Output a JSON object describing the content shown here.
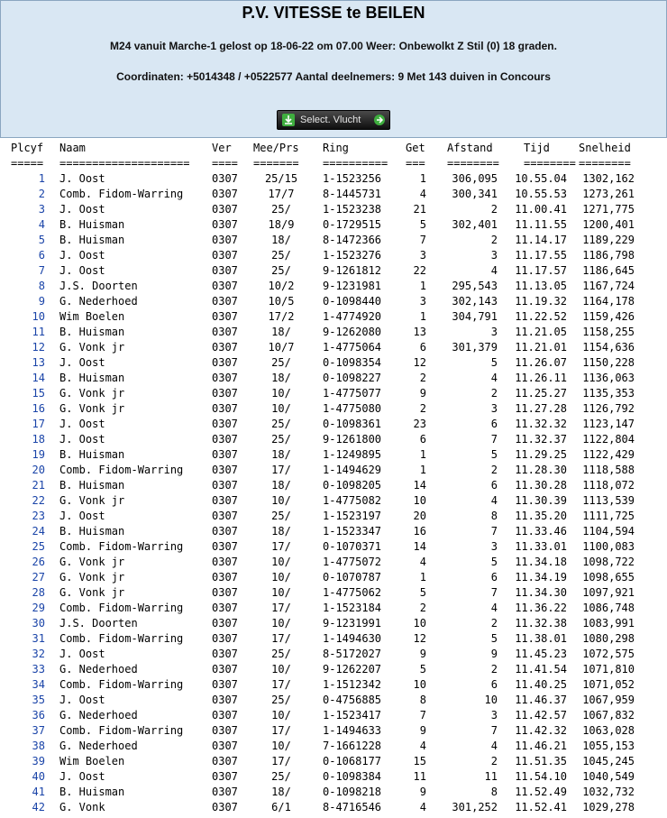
{
  "header": {
    "title": "P.V. VITESSE te BEILEN",
    "flight_info": "M24 vanuit Marche-1 gelost op 18-06-22 om 07.00 Weer: Onbewolkt Z Stil (0) 18 graden.",
    "coords_info": "Coordinaten: +5014348 / +0522577 Aantal deelnemers: 9 Met 143 duiven in Concours"
  },
  "toolbar": {
    "select_label": "Select. Vlucht",
    "icons": [
      "download-icon",
      "arrow-right-icon"
    ],
    "accent_color": "#3fae3f"
  },
  "table": {
    "headers": {
      "plcyf": "Plcyf",
      "naam": "Naam",
      "ver": "Ver",
      "mee": "Mee/Prs",
      "ring": "Ring",
      "get": "Get",
      "afstand": "Afstand",
      "tijd": "Tijd",
      "snelheid": "Snelheid"
    },
    "separators": {
      "plcyf": "=====",
      "naam": "====================",
      "ver": "====",
      "mee": "=======",
      "ring": "==========",
      "get": "===",
      "afstand": "========",
      "tijd": "========",
      "snelheid": "========"
    },
    "rows": [
      {
        "plc": "1",
        "naam": "J. Oost",
        "ver": "0307",
        "mee": "25/15",
        "ring": "1-1523256",
        "get": "1",
        "afstand": "306,095",
        "tijd": "10.55.04",
        "snelheid": "1302,162"
      },
      {
        "plc": "2",
        "naam": "Comb. Fidom-Warring",
        "ver": "0307",
        "mee": "17/7",
        "ring": "8-1445731",
        "get": "4",
        "afstand": "300,341",
        "tijd": "10.55.53",
        "snelheid": "1273,261"
      },
      {
        "plc": "3",
        "naam": "J. Oost",
        "ver": "0307",
        "mee": "25/",
        "ring": "1-1523238",
        "get": "21",
        "afstand": "2",
        "tijd": "11.00.41",
        "snelheid": "1271,775"
      },
      {
        "plc": "4",
        "naam": "B. Huisman",
        "ver": "0307",
        "mee": "18/9",
        "ring": "0-1729515",
        "get": "5",
        "afstand": "302,401",
        "tijd": "11.11.55",
        "snelheid": "1200,401"
      },
      {
        "plc": "5",
        "naam": "B. Huisman",
        "ver": "0307",
        "mee": "18/",
        "ring": "8-1472366",
        "get": "7",
        "afstand": "2",
        "tijd": "11.14.17",
        "snelheid": "1189,229"
      },
      {
        "plc": "6",
        "naam": "J. Oost",
        "ver": "0307",
        "mee": "25/",
        "ring": "1-1523276",
        "get": "3",
        "afstand": "3",
        "tijd": "11.17.55",
        "snelheid": "1186,798"
      },
      {
        "plc": "7",
        "naam": "J. Oost",
        "ver": "0307",
        "mee": "25/",
        "ring": "9-1261812",
        "get": "22",
        "afstand": "4",
        "tijd": "11.17.57",
        "snelheid": "1186,645"
      },
      {
        "plc": "8",
        "naam": "J.S. Doorten",
        "ver": "0307",
        "mee": "10/2",
        "ring": "9-1231981",
        "get": "1",
        "afstand": "295,543",
        "tijd": "11.13.05",
        "snelheid": "1167,724"
      },
      {
        "plc": "9",
        "naam": "G. Nederhoed",
        "ver": "0307",
        "mee": "10/5",
        "ring": "0-1098440",
        "get": "3",
        "afstand": "302,143",
        "tijd": "11.19.32",
        "snelheid": "1164,178"
      },
      {
        "plc": "10",
        "naam": "Wim Boelen",
        "ver": "0307",
        "mee": "17/2",
        "ring": "1-4774920",
        "get": "1",
        "afstand": "304,791",
        "tijd": "11.22.52",
        "snelheid": "1159,426"
      },
      {
        "plc": "11",
        "naam": "B. Huisman",
        "ver": "0307",
        "mee": "18/",
        "ring": "9-1262080",
        "get": "13",
        "afstand": "3",
        "tijd": "11.21.05",
        "snelheid": "1158,255"
      },
      {
        "plc": "12",
        "naam": "G. Vonk jr",
        "ver": "0307",
        "mee": "10/7",
        "ring": "1-4775064",
        "get": "6",
        "afstand": "301,379",
        "tijd": "11.21.01",
        "snelheid": "1154,636"
      },
      {
        "plc": "13",
        "naam": "J. Oost",
        "ver": "0307",
        "mee": "25/",
        "ring": "0-1098354",
        "get": "12",
        "afstand": "5",
        "tijd": "11.26.07",
        "snelheid": "1150,228"
      },
      {
        "plc": "14",
        "naam": "B. Huisman",
        "ver": "0307",
        "mee": "18/",
        "ring": "0-1098227",
        "get": "2",
        "afstand": "4",
        "tijd": "11.26.11",
        "snelheid": "1136,063"
      },
      {
        "plc": "15",
        "naam": "G. Vonk jr",
        "ver": "0307",
        "mee": "10/",
        "ring": "1-4775077",
        "get": "9",
        "afstand": "2",
        "tijd": "11.25.27",
        "snelheid": "1135,353"
      },
      {
        "plc": "16",
        "naam": "G. Vonk jr",
        "ver": "0307",
        "mee": "10/",
        "ring": "1-4775080",
        "get": "2",
        "afstand": "3",
        "tijd": "11.27.28",
        "snelheid": "1126,792"
      },
      {
        "plc": "17",
        "naam": "J. Oost",
        "ver": "0307",
        "mee": "25/",
        "ring": "0-1098361",
        "get": "23",
        "afstand": "6",
        "tijd": "11.32.32",
        "snelheid": "1123,147"
      },
      {
        "plc": "18",
        "naam": "J. Oost",
        "ver": "0307",
        "mee": "25/",
        "ring": "9-1261800",
        "get": "6",
        "afstand": "7",
        "tijd": "11.32.37",
        "snelheid": "1122,804"
      },
      {
        "plc": "19",
        "naam": "B. Huisman",
        "ver": "0307",
        "mee": "18/",
        "ring": "1-1249895",
        "get": "1",
        "afstand": "5",
        "tijd": "11.29.25",
        "snelheid": "1122,429"
      },
      {
        "plc": "20",
        "naam": "Comb. Fidom-Warring",
        "ver": "0307",
        "mee": "17/",
        "ring": "1-1494629",
        "get": "1",
        "afstand": "2",
        "tijd": "11.28.30",
        "snelheid": "1118,588"
      },
      {
        "plc": "21",
        "naam": "B. Huisman",
        "ver": "0307",
        "mee": "18/",
        "ring": "0-1098205",
        "get": "14",
        "afstand": "6",
        "tijd": "11.30.28",
        "snelheid": "1118,072"
      },
      {
        "plc": "22",
        "naam": "G. Vonk jr",
        "ver": "0307",
        "mee": "10/",
        "ring": "1-4775082",
        "get": "10",
        "afstand": "4",
        "tijd": "11.30.39",
        "snelheid": "1113,539"
      },
      {
        "plc": "23",
        "naam": "J. Oost",
        "ver": "0307",
        "mee": "25/",
        "ring": "1-1523197",
        "get": "20",
        "afstand": "8",
        "tijd": "11.35.20",
        "snelheid": "1111,725"
      },
      {
        "plc": "24",
        "naam": "B. Huisman",
        "ver": "0307",
        "mee": "18/",
        "ring": "1-1523347",
        "get": "16",
        "afstand": "7",
        "tijd": "11.33.46",
        "snelheid": "1104,594"
      },
      {
        "plc": "25",
        "naam": "Comb. Fidom-Warring",
        "ver": "0307",
        "mee": "17/",
        "ring": "0-1070371",
        "get": "14",
        "afstand": "3",
        "tijd": "11.33.01",
        "snelheid": "1100,083"
      },
      {
        "plc": "26",
        "naam": "G. Vonk jr",
        "ver": "0307",
        "mee": "10/",
        "ring": "1-4775072",
        "get": "4",
        "afstand": "5",
        "tijd": "11.34.18",
        "snelheid": "1098,722"
      },
      {
        "plc": "27",
        "naam": "G. Vonk jr",
        "ver": "0307",
        "mee": "10/",
        "ring": "0-1070787",
        "get": "1",
        "afstand": "6",
        "tijd": "11.34.19",
        "snelheid": "1098,655"
      },
      {
        "plc": "28",
        "naam": "G. Vonk jr",
        "ver": "0307",
        "mee": "10/",
        "ring": "1-4775062",
        "get": "5",
        "afstand": "7",
        "tijd": "11.34.30",
        "snelheid": "1097,921"
      },
      {
        "plc": "29",
        "naam": "Comb. Fidom-Warring",
        "ver": "0307",
        "mee": "17/",
        "ring": "1-1523184",
        "get": "2",
        "afstand": "4",
        "tijd": "11.36.22",
        "snelheid": "1086,748"
      },
      {
        "plc": "30",
        "naam": "J.S. Doorten",
        "ver": "0307",
        "mee": "10/",
        "ring": "9-1231991",
        "get": "10",
        "afstand": "2",
        "tijd": "11.32.38",
        "snelheid": "1083,991"
      },
      {
        "plc": "31",
        "naam": "Comb. Fidom-Warring",
        "ver": "0307",
        "mee": "17/",
        "ring": "1-1494630",
        "get": "12",
        "afstand": "5",
        "tijd": "11.38.01",
        "snelheid": "1080,298"
      },
      {
        "plc": "32",
        "naam": "J. Oost",
        "ver": "0307",
        "mee": "25/",
        "ring": "8-5172027",
        "get": "9",
        "afstand": "9",
        "tijd": "11.45.23",
        "snelheid": "1072,575"
      },
      {
        "plc": "33",
        "naam": "G. Nederhoed",
        "ver": "0307",
        "mee": "10/",
        "ring": "9-1262207",
        "get": "5",
        "afstand": "2",
        "tijd": "11.41.54",
        "snelheid": "1071,810"
      },
      {
        "plc": "34",
        "naam": "Comb. Fidom-Warring",
        "ver": "0307",
        "mee": "17/",
        "ring": "1-1512342",
        "get": "10",
        "afstand": "6",
        "tijd": "11.40.25",
        "snelheid": "1071,052"
      },
      {
        "plc": "35",
        "naam": "J. Oost",
        "ver": "0307",
        "mee": "25/",
        "ring": "0-4756885",
        "get": "8",
        "afstand": "10",
        "tijd": "11.46.37",
        "snelheid": "1067,959"
      },
      {
        "plc": "36",
        "naam": "G. Nederhoed",
        "ver": "0307",
        "mee": "10/",
        "ring": "1-1523417",
        "get": "7",
        "afstand": "3",
        "tijd": "11.42.57",
        "snelheid": "1067,832"
      },
      {
        "plc": "37",
        "naam": "Comb. Fidom-Warring",
        "ver": "0307",
        "mee": "17/",
        "ring": "1-1494633",
        "get": "9",
        "afstand": "7",
        "tijd": "11.42.32",
        "snelheid": "1063,028"
      },
      {
        "plc": "38",
        "naam": "G. Nederhoed",
        "ver": "0307",
        "mee": "10/",
        "ring": "7-1661228",
        "get": "4",
        "afstand": "4",
        "tijd": "11.46.21",
        "snelheid": "1055,153"
      },
      {
        "plc": "39",
        "naam": "Wim Boelen",
        "ver": "0307",
        "mee": "17/",
        "ring": "0-1068177",
        "get": "15",
        "afstand": "2",
        "tijd": "11.51.35",
        "snelheid": "1045,245"
      },
      {
        "plc": "40",
        "naam": "J. Oost",
        "ver": "0307",
        "mee": "25/",
        "ring": "0-1098384",
        "get": "11",
        "afstand": "11",
        "tijd": "11.54.10",
        "snelheid": "1040,549"
      },
      {
        "plc": "41",
        "naam": "B. Huisman",
        "ver": "0307",
        "mee": "18/",
        "ring": "0-1098218",
        "get": "9",
        "afstand": "8",
        "tijd": "11.52.49",
        "snelheid": "1032,732"
      },
      {
        "plc": "42",
        "naam": "G. Vonk",
        "ver": "0307",
        "mee": "6/1",
        "ring": "8-4716546",
        "get": "4",
        "afstand": "301,252",
        "tijd": "11.52.41",
        "snelheid": "1029,278"
      }
    ]
  }
}
